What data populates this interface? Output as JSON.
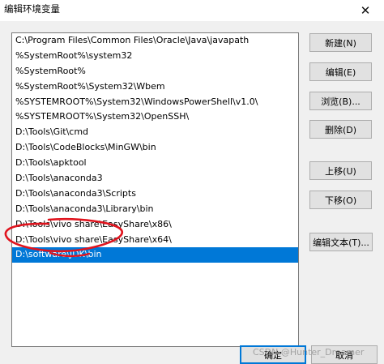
{
  "window": {
    "title": "编辑环境变量",
    "close_glyph": "✕"
  },
  "paths": [
    "C:\\Program Files\\Common Files\\Oracle\\Java\\javapath",
    "%SystemRoot%\\system32",
    "%SystemRoot%",
    "%SystemRoot%\\System32\\Wbem",
    "%SYSTEMROOT%\\System32\\WindowsPowerShell\\v1.0\\",
    "%SYSTEMROOT%\\System32\\OpenSSH\\",
    "D:\\Tools\\Git\\cmd",
    "D:\\Tools\\CodeBlocks\\MinGW\\bin",
    "D:\\Tools\\apktool",
    "D:\\Tools\\anaconda3",
    "D:\\Tools\\anaconda3\\Scripts",
    "D:\\Tools\\anaconda3\\Library\\bin",
    "D:\\Tools\\vivo share\\EasyShare\\x86\\",
    "D:\\Tools\\vivo share\\EasyShare\\x64\\",
    "D:\\software\\JDK\\bin"
  ],
  "selected_index": 14,
  "buttons": {
    "new": "新建(N)",
    "edit": "编辑(E)",
    "browse": "浏览(B)...",
    "delete": "删除(D)",
    "move_up": "上移(U)",
    "move_down": "下移(O)",
    "edit_text": "编辑文本(T)..."
  },
  "footer": {
    "ok": "确定",
    "cancel": "取消"
  },
  "watermark": "CSDN @Hunter_Dreamer",
  "colors": {
    "selection": "#0078d7",
    "annotation": "#e0141e"
  }
}
